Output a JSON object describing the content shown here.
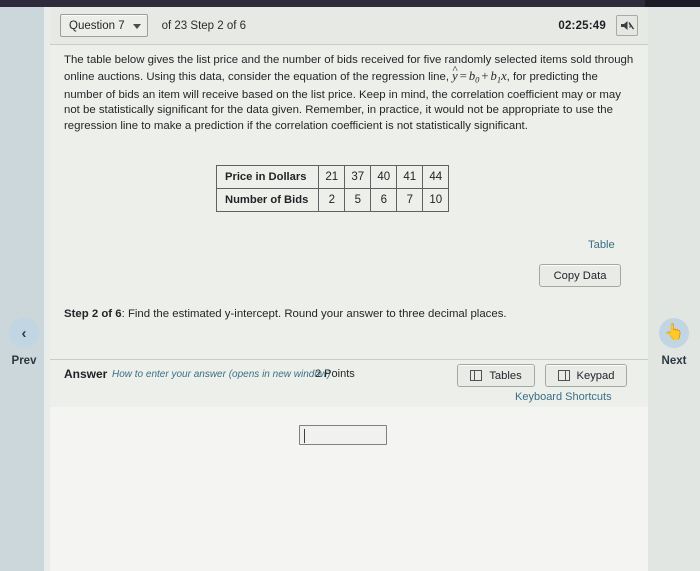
{
  "header": {
    "question_selector": "Question 7",
    "caret_icon": "chevron-down-icon",
    "progress": "of 23 Step 2 of 6",
    "timer": "02:25:49",
    "mute_icon": "speaker-muted-icon"
  },
  "problem": {
    "part1": "The table below gives the list price and the number of bids received for five randomly selected items sold through online auctions. Using this data, consider the equation of the regression line, ",
    "formula": {
      "yhat": "y",
      "hat": "^",
      "equals": "=",
      "b0": "b",
      "b0_sub": "0",
      "plus": "+",
      "b1": "b",
      "b1_sub": "1",
      "x": "x",
      "comma": ","
    },
    "part2": " for predicting the number of bids an item will receive based on the list price. Keep in mind, the correlation coefficient may or may not be statistically significant for the data given. Remember, in practice, it would not be appropriate to use the regression line to make a prediction if the correlation coefficient is not statistically significant."
  },
  "data_table": {
    "rows": [
      {
        "label": "Price in Dollars",
        "values": [
          "21",
          "37",
          "40",
          "41",
          "44"
        ]
      },
      {
        "label": "Number of Bids",
        "values": [
          "2",
          "5",
          "6",
          "7",
          "10"
        ]
      }
    ]
  },
  "table_tools": {
    "table_link": "Table",
    "copy_data_button": "Copy Data"
  },
  "step": {
    "prefix": "Step 2 of 6",
    "text": ": Find the estimated y-intercept. Round your answer to three decimal places."
  },
  "answer_bar": {
    "label": "Answer",
    "help_link": "How to enter your answer (opens in new window)",
    "points": "2 Points",
    "tables_button": "Tables",
    "tables_icon": "grid-table-icon",
    "keypad_button": "Keypad",
    "keypad_icon": "keypad-grid-icon",
    "keyboard_shortcuts_link": "Keyboard Shortcuts"
  },
  "answer_input": {
    "value": "",
    "placeholder": ""
  },
  "nav": {
    "prev_label": "Prev",
    "prev_icon": "chevron-left-icon",
    "next_label": "Next",
    "next_icon": "pointing-hand-cursor-icon"
  },
  "colors": {
    "link": "#3a6f87",
    "nav_circle": "#c2d5e2",
    "page_bg": "#edefea",
    "top_strip": "#2f2b3c"
  }
}
